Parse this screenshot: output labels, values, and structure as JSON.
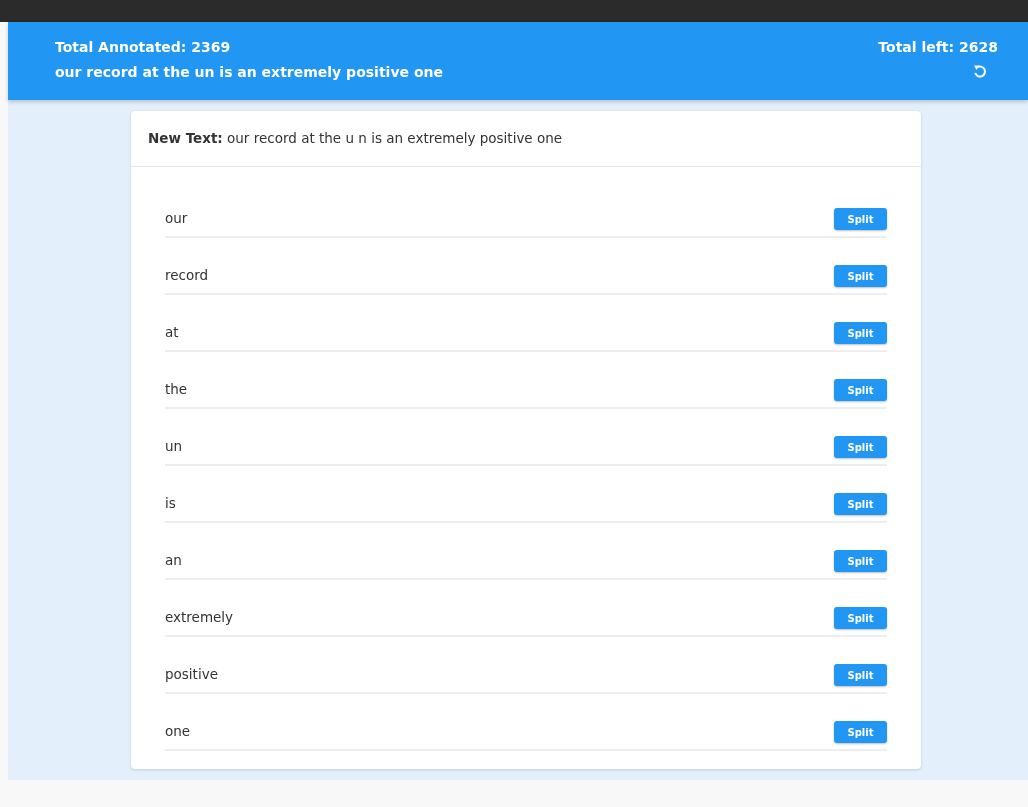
{
  "header": {
    "total_annotated": "Total Annotated: 2369",
    "sentence": "our record at the un is an extremely positive one",
    "total_left": "Total left: 2628"
  },
  "card": {
    "label": "New Text:",
    "text": "our record at the u n is an extremely positive one"
  },
  "tokens": [
    {
      "word": "our",
      "button": "Split"
    },
    {
      "word": "record",
      "button": "Split"
    },
    {
      "word": "at",
      "button": "Split"
    },
    {
      "word": "the",
      "button": "Split"
    },
    {
      "word": "un",
      "button": "Split"
    },
    {
      "word": "is",
      "button": "Split"
    },
    {
      "word": "an",
      "button": "Split"
    },
    {
      "word": "extremely",
      "button": "Split"
    },
    {
      "word": "positive",
      "button": "Split"
    },
    {
      "word": "one",
      "button": "Split"
    }
  ]
}
